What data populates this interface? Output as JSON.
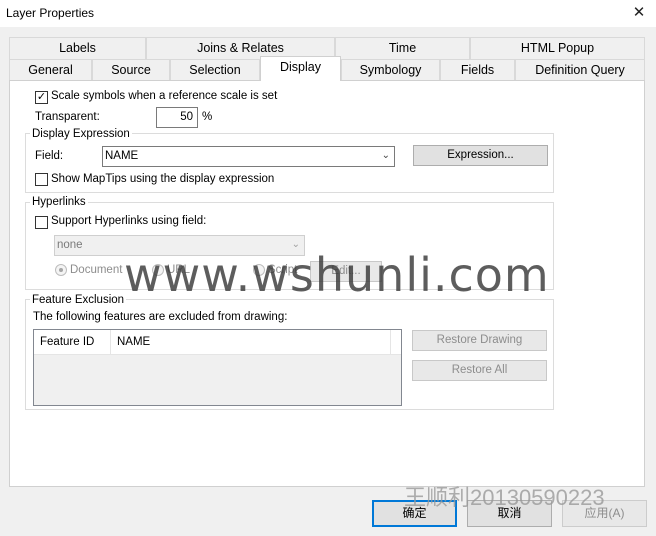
{
  "window": {
    "title": "Layer Properties",
    "close_glyph": "✕"
  },
  "tabs_row1": [
    {
      "label": "Labels"
    },
    {
      "label": "Joins & Relates"
    },
    {
      "label": "Time"
    },
    {
      "label": "HTML Popup"
    }
  ],
  "tabs_row2": [
    {
      "label": "General"
    },
    {
      "label": "Source"
    },
    {
      "label": "Selection"
    },
    {
      "label": "Display",
      "active": true
    },
    {
      "label": "Symbology"
    },
    {
      "label": "Fields"
    },
    {
      "label": "Definition Query"
    }
  ],
  "display": {
    "scale_symbols_label": "Scale symbols when a reference scale is set",
    "scale_symbols_checked": true,
    "transparent_label": "Transparent:",
    "transparent_value": "50",
    "transparent_unit": "%"
  },
  "display_expression": {
    "group_title": "Display Expression",
    "field_label": "Field:",
    "field_value": "NAME",
    "expression_button": "Expression...",
    "maptips_label": "Show MapTips using the display expression",
    "maptips_checked": false
  },
  "hyperlinks": {
    "group_title": "Hyperlinks",
    "support_label": "Support Hyperlinks using field:",
    "support_checked": false,
    "field_value": "none",
    "radio_document": "Document",
    "radio_url": "URL",
    "radio_script": "Script",
    "edit_button": "Edit..."
  },
  "feature_exclusion": {
    "group_title": "Feature Exclusion",
    "description": "The following features are excluded from drawing:",
    "columns": [
      "Feature ID",
      "NAME"
    ],
    "restore_drawing_button": "Restore Drawing",
    "restore_all_button": "Restore All"
  },
  "watermark": {
    "main": "www.wshunli.com",
    "secondary": "王顺利20130590223"
  },
  "footer": {
    "ok": "确定",
    "cancel": "取消",
    "apply": "应用(A)"
  }
}
